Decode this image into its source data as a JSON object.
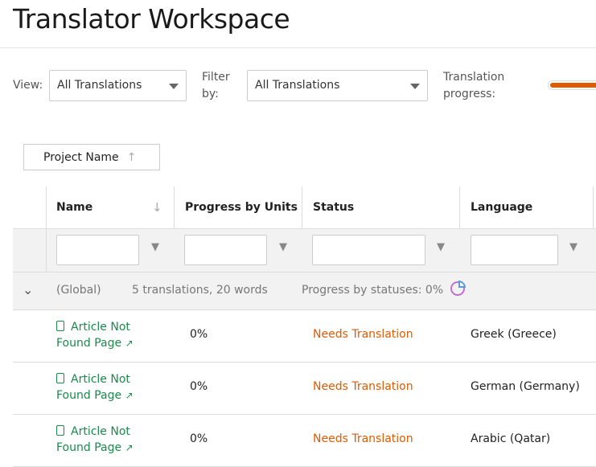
{
  "title": "Translator Workspace",
  "controls": {
    "view_label": "View:",
    "view_value": "All Translations",
    "filter_label": "Filter by:",
    "filter_value": "All Translations",
    "progress_label": "Translation progress:",
    "progress_percent": 100,
    "progress_color": "#e05a00"
  },
  "sort_button": {
    "label": "Project Name",
    "icon": "arrow-up-icon"
  },
  "columns": [
    "Name",
    "Progress by Units",
    "Status",
    "Language"
  ],
  "group": {
    "label": "(Global)",
    "summary": "5 translations, 20 words",
    "progress": "Progress by statuses: 0%"
  },
  "rows": [
    {
      "name": "Article Not Found Page",
      "progress": "0%",
      "status": "Needs Translation",
      "language": "Greek (Greece)"
    },
    {
      "name": "Article Not Found Page",
      "progress": "0%",
      "status": "Needs Translation",
      "language": "German (Germany)"
    },
    {
      "name": "Article Not Found Page",
      "progress": "0%",
      "status": "Needs Translation",
      "language": "Arabic (Qatar)"
    }
  ]
}
